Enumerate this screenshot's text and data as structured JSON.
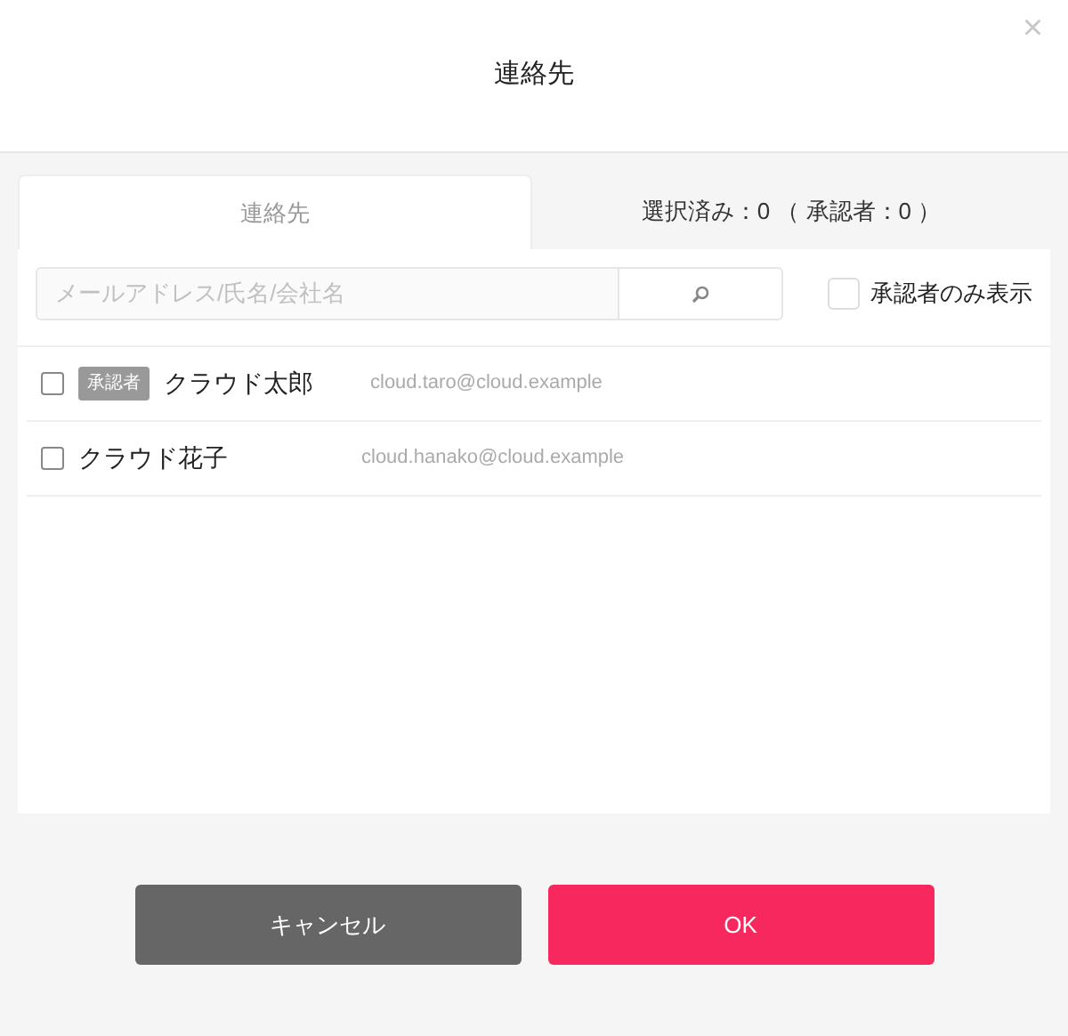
{
  "dialog": {
    "title": "連絡先",
    "close": "×"
  },
  "tabs": [
    {
      "label": "連絡先",
      "selected": true
    },
    {
      "label": "選択済み：0 （ 承認者：0 ）",
      "selected": false
    }
  ],
  "search": {
    "placeholder": "メールアドレス/氏名/会社名"
  },
  "approver_filter": {
    "label": "承認者のみ表示",
    "checked": false
  },
  "contacts": [
    {
      "checked": false,
      "badge": "承認者",
      "name": "クラウド太郎",
      "email": "cloud.taro@cloud.example"
    },
    {
      "checked": false,
      "name": "クラウド花子",
      "email": "cloud.hanako@cloud.example"
    }
  ],
  "buttons": [
    {
      "kind": "cancel",
      "label": "キャンセル"
    },
    {
      "kind": "ok",
      "label": "OK"
    }
  ]
}
